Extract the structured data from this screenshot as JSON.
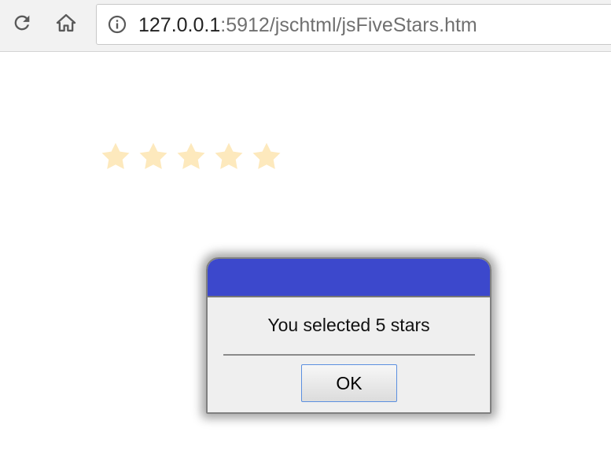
{
  "browser": {
    "url_host": "127.0.0.1",
    "url_rest": ":5912/jschtml/jsFiveStars.htm",
    "icons": {
      "reload": "reload-icon",
      "home": "home-icon",
      "info": "info-icon"
    }
  },
  "rating": {
    "selected": 5,
    "max": 5,
    "star_color": "#fde9bd"
  },
  "dialog": {
    "message": "You selected 5 stars",
    "ok_label": "OK",
    "titlebar_color": "#3c48cc"
  }
}
